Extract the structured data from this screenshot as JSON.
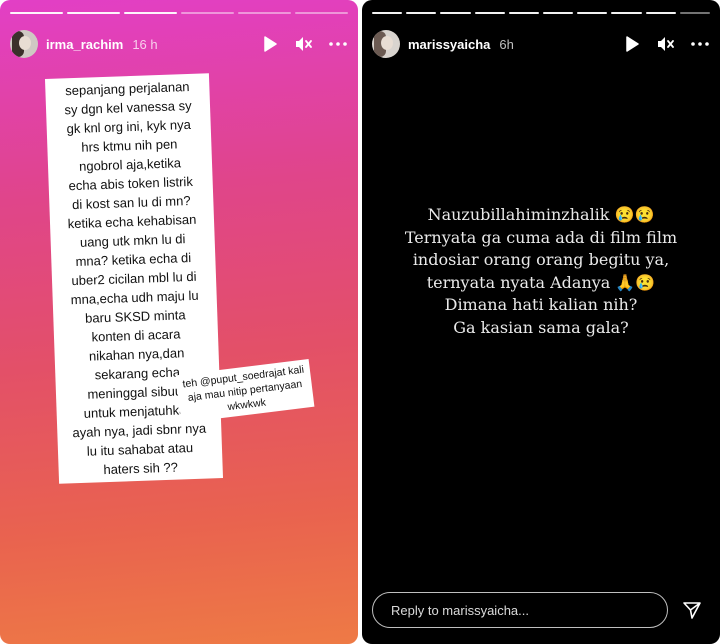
{
  "left_story": {
    "username": "irma_rachim",
    "time": "16 h",
    "avatar_icon": "profile-photo",
    "text_lines": [
      "sepanjang perjalanan",
      "sy dgn kel vanessa sy",
      "gk knl org ini, kyk nya",
      "hrs ktmu nih pen",
      "ngobrol aja,ketika",
      "echa abis token listrik",
      "di kost san lu di mn?",
      "ketika echa kehabisan",
      "uang utk mkn lu di",
      "mna? ketika echa di",
      "uber2 cicilan mbl lu di",
      "mna,echa udh maju lu",
      "baru SKSD minta",
      "konten di acara",
      "nikahan nya,dan",
      "sekarang echa",
      "meninggal sibuuk",
      "untuk menjatuhkan",
      "ayah nya, jadi sbnr nya",
      "lu itu sahabat atau",
      "haters sih ??"
    ],
    "side_note": "teh @puput_soedrajat kali aja mau nitip pertanyaan wkwkwk"
  },
  "right_story": {
    "username": "marissyaicha",
    "time": "6h",
    "avatar_icon": "profile-photo",
    "message": "Nauzubillahiminzhalik 😢😢\nTernyata ga cuma ada di film film\nindosiar orang orang begitu ya,\nternyata nyata Adanya 🙏😢\nDimana hati kalian nih?\nGa kasian sama gala?",
    "reply_placeholder": "Reply to marissyaicha..."
  },
  "icons": {
    "play": "play-icon",
    "mute": "mute-icon",
    "more": "more-icon",
    "send": "send-icon"
  },
  "colors": {
    "left_gradient_top": "#e23fc6",
    "left_gradient_bottom": "#ee7a45",
    "right_background": "#000000"
  }
}
